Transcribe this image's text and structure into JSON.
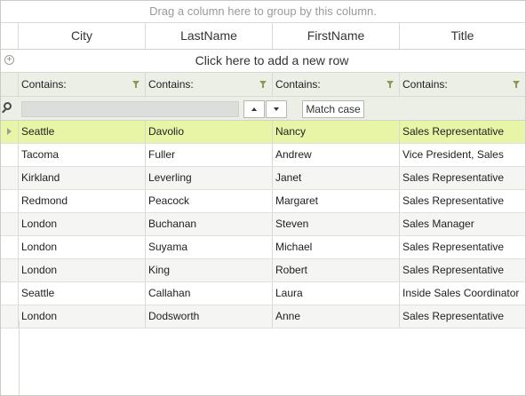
{
  "group_panel": {
    "text": "Drag a column here to group by this column."
  },
  "columns": [
    "City",
    "LastName",
    "FirstName",
    "Title"
  ],
  "new_row": {
    "text": "Click here to add a new row"
  },
  "filters": [
    {
      "label": "Contains:"
    },
    {
      "label": "Contains:"
    },
    {
      "label": "Contains:"
    },
    {
      "label": "Contains:"
    }
  ],
  "search": {
    "value": "",
    "match_case_label": "Match case"
  },
  "rows": [
    {
      "city": "Seattle",
      "last": "Davolio",
      "first": "Nancy",
      "title": "Sales Representative"
    },
    {
      "city": "Tacoma",
      "last": "Fuller",
      "first": "Andrew",
      "title": "Vice President, Sales"
    },
    {
      "city": "Kirkland",
      "last": "Leverling",
      "first": "Janet",
      "title": "Sales Representative"
    },
    {
      "city": "Redmond",
      "last": "Peacock",
      "first": "Margaret",
      "title": "Sales Representative"
    },
    {
      "city": "London",
      "last": "Buchanan",
      "first": "Steven",
      "title": "Sales Manager"
    },
    {
      "city": "London",
      "last": "Suyama",
      "first": "Michael",
      "title": "Sales Representative"
    },
    {
      "city": "London",
      "last": "King",
      "first": "Robert",
      "title": "Sales Representative"
    },
    {
      "city": "Seattle",
      "last": "Callahan",
      "first": "Laura",
      "title": "Inside Sales Coordinator"
    },
    {
      "city": "London",
      "last": "Dodsworth",
      "first": "Anne",
      "title": "Sales Representative"
    }
  ],
  "selected_row": 0,
  "colors": {
    "selected": "#e8f5a6",
    "filter_bg": "#ecefe6",
    "accent": "#8a9b59"
  }
}
